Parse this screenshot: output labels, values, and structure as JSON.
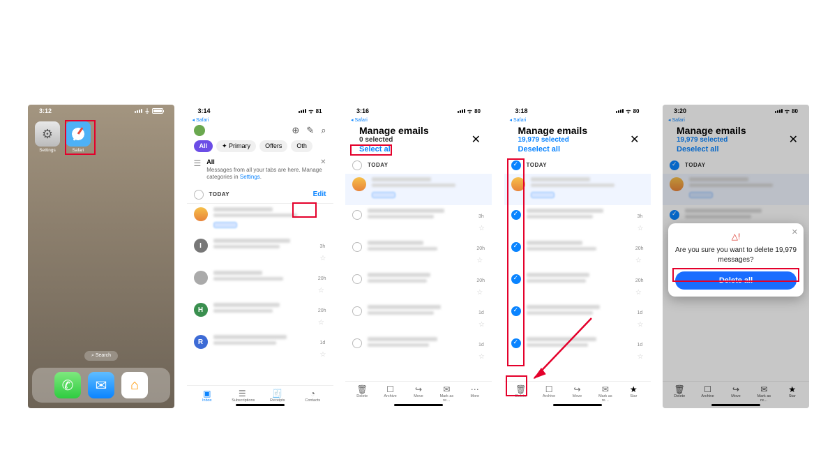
{
  "phone1": {
    "time": "3:12",
    "apps": {
      "settings": "Settings",
      "safari": "Safari"
    },
    "search": "⌕ Search",
    "highlight": "safari"
  },
  "phone2": {
    "time": "3:14",
    "breadcrumb": "◂ Safari",
    "battery": "81",
    "tabs": {
      "all": "All",
      "primary": "✦ Primary",
      "offers": "Offers",
      "other": "Oth"
    },
    "banner": {
      "title": "All",
      "body_a": "Messages from all your tabs are here. Manage categories in ",
      "body_link": "Settings",
      "body_b": "."
    },
    "today": "TODAY",
    "edit": "Edit",
    "rows": [
      {
        "time": "",
        "avatar_bg": "#f3b04a"
      },
      {
        "time": "3h",
        "avatar_bg": "#777",
        "letter": "I"
      },
      {
        "time": "20h",
        "avatar_bg": "#9aa"
      },
      {
        "time": "20h",
        "avatar_bg": "#3a8f4f",
        "letter": "H"
      },
      {
        "time": "1d",
        "avatar_bg": "#3d6bd6",
        "letter": "R"
      }
    ],
    "nav": {
      "inbox": "Inbox",
      "subs": "Subscriptions",
      "receipts": "Receipts",
      "contacts": "Contacts"
    }
  },
  "phone3": {
    "time": "3:16",
    "breadcrumb": "◂ Safari",
    "battery": "80",
    "title": "Manage emails",
    "subtitle": "0 selected",
    "action": "Select all",
    "today": "TODAY",
    "rows": [
      {
        "time": ""
      },
      {
        "time": "3h"
      },
      {
        "time": "20h"
      },
      {
        "time": "20h"
      },
      {
        "time": "1d"
      },
      {
        "time": "1d"
      }
    ],
    "nav": {
      "delete": "Delete",
      "archive": "Archive",
      "move": "Move",
      "mark": "Mark as re…",
      "more": "More"
    }
  },
  "phone4": {
    "time": "3:18",
    "breadcrumb": "◂ Safari",
    "battery": "80",
    "title": "Manage emails",
    "subtitle": "19,979 selected",
    "action": "Deselect all",
    "today": "TODAY",
    "rows": [
      {
        "time": ""
      },
      {
        "time": "3h"
      },
      {
        "time": "20h"
      },
      {
        "time": "20h"
      },
      {
        "time": "1d"
      },
      {
        "time": "1d"
      }
    ],
    "nav": {
      "delete": "Delete",
      "archive": "Archive",
      "move": "Move",
      "mark": "Mark as re…",
      "star": "Star"
    }
  },
  "phone5": {
    "time": "3:20",
    "breadcrumb": "◂ Safari",
    "battery": "80",
    "title": "Manage emails",
    "subtitle": "19,979 selected",
    "action": "Deselect all",
    "today": "TODAY",
    "dialog": {
      "message": "Are you sure you want to delete 19,979 messages?",
      "button": "Delete all"
    },
    "nav": {
      "delete": "Delete",
      "archive": "Archive",
      "move": "Move",
      "mark": "Mark as re…",
      "star": "Star"
    }
  },
  "colors": {
    "highlight": "#e4002b",
    "link": "#0a84ff",
    "primary_button": "#1a6dff"
  }
}
